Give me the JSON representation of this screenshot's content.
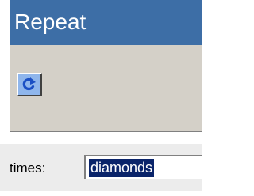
{
  "palette": {
    "title": "Repeat",
    "button_icon": "repeat-arrow-icon",
    "title_color": "#3d6ea6"
  },
  "times_field": {
    "label": "times:",
    "value": "diamonds",
    "value_selected": true,
    "selection_color": "#0a246a"
  }
}
